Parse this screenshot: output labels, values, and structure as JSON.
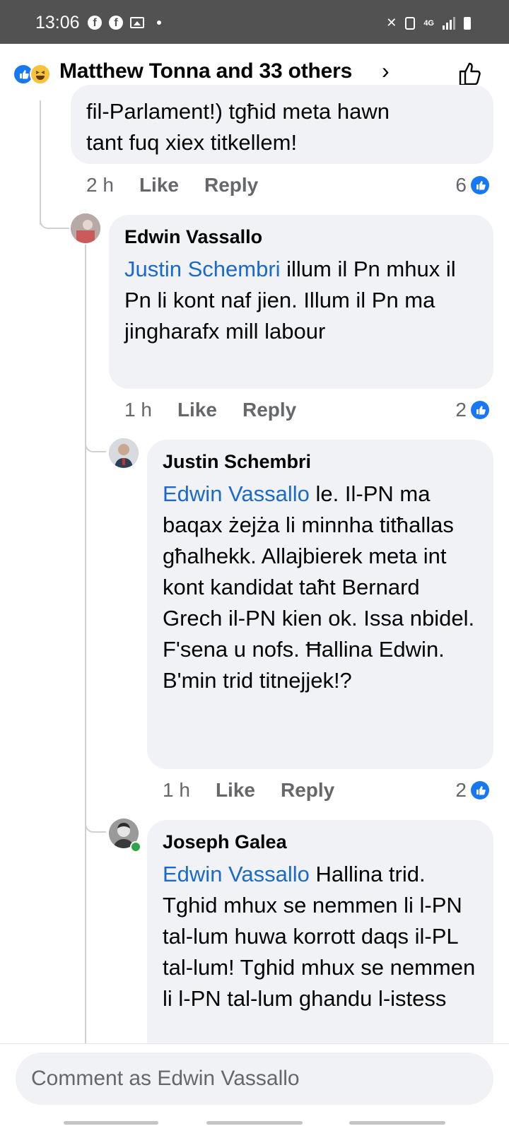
{
  "status_bar": {
    "time": "13:06",
    "network": "4G"
  },
  "header": {
    "title": "Matthew Tonna and 33 others",
    "chevron": "›",
    "reaction_icons": [
      "like-icon",
      "haha-icon"
    ],
    "like_action_icon": "thumbs-up-outline-icon"
  },
  "comments": [
    {
      "partial_text_lines": [
        "fil-Parlament!) tgħid meta hawn",
        "tant fuq xiex titkellem!"
      ],
      "time": "2 h",
      "like_label": "Like",
      "reply_label": "Reply",
      "like_count": "6"
    },
    {
      "author": "Edwin Vassallo",
      "mention": "Justin Schembri",
      "text": " illum il Pn mhux il Pn li kont naf jien. Illum il Pn ma jingharafx mill labour",
      "time": "1 h",
      "like_label": "Like",
      "reply_label": "Reply",
      "like_count": "2"
    },
    {
      "author": "Justin Schembri",
      "mention": "Edwin Vassallo",
      "text": " le. Il-PN ma baqax żejża li minnha titħallas għalhekk. Allajbierek meta int kont kandidat taħt Bernard Grech il-PN kien ok. Issa nbidel. F'sena u nofs. Ħallina Edwin. B'min trid titnejjek!?",
      "time": "1 h",
      "like_label": "Like",
      "reply_label": "Reply",
      "like_count": "2"
    },
    {
      "author": "Joseph Galea",
      "mention": "Edwin Vassallo",
      "text": " Hallina trid. Tghid mhux se nemmen li l-PN tal-lum huwa korrott daqs il-PL tal-lum! Tghid mhux se nemmen li l-PN tal-lum ghandu l-istess"
    }
  ],
  "composer": {
    "placeholder": "Comment as Edwin Vassallo"
  },
  "colors": {
    "accent": "#1877f2",
    "mention": "#1b6ac9",
    "bubble": "#f0f2f5",
    "status_bar": "#525252"
  }
}
